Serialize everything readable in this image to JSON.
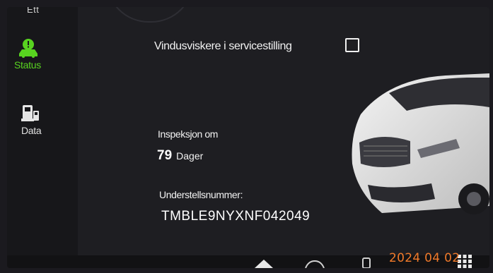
{
  "sidebar": {
    "items": [
      {
        "label": "Status",
        "icon": "car-status-icon",
        "active": true
      },
      {
        "label": "Data",
        "icon": "fuel-data-icon",
        "active": false
      }
    ],
    "cut_label": "Ett"
  },
  "main": {
    "wiper_service": {
      "label": "Vindusviskere i servicestilling",
      "checked": false
    },
    "inspection": {
      "label": "Inspeksjon om",
      "value": "79",
      "unit": "Dager"
    },
    "vin": {
      "label": "Understellsnummer:",
      "value": "TMBLE9NYXNF042049"
    }
  },
  "photo": {
    "date_stamp": "2024 04 02"
  },
  "colors": {
    "accent": "#58d320",
    "background": "#1e1e22",
    "date": "#f07a2a"
  }
}
